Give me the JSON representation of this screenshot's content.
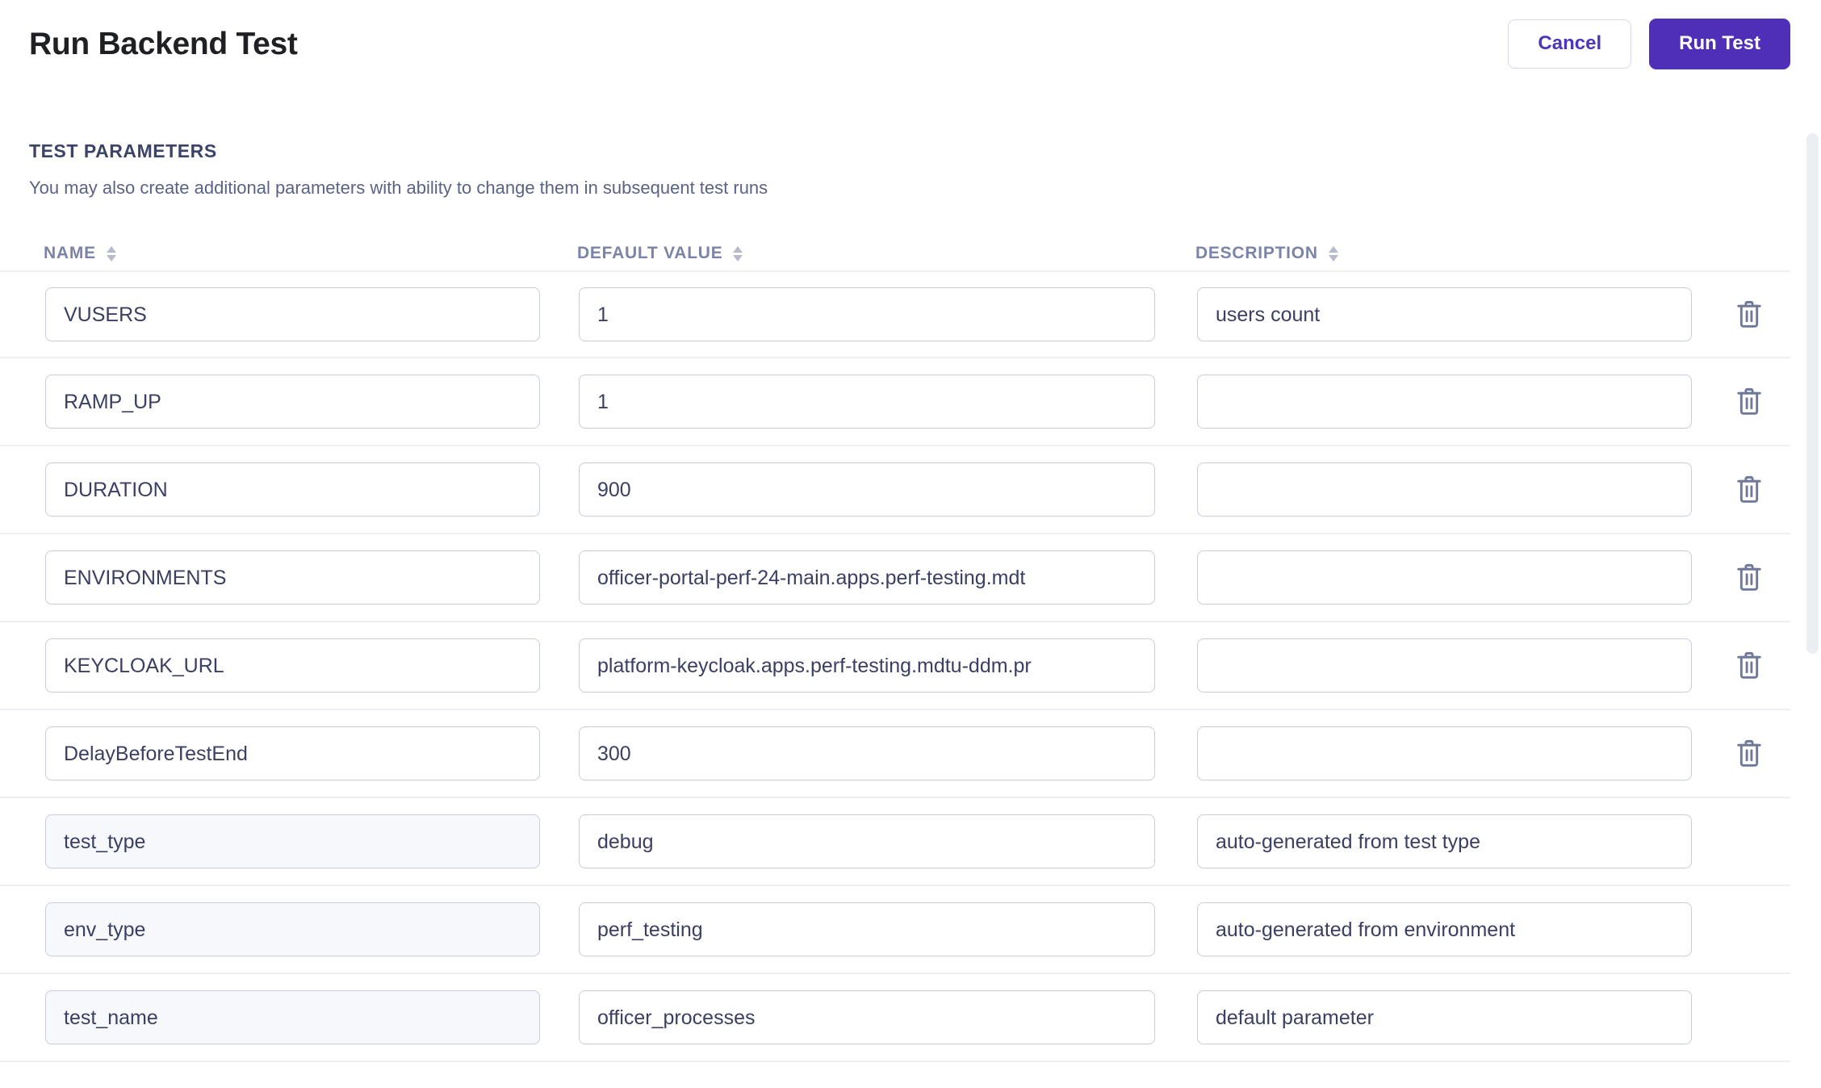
{
  "header": {
    "title": "Run Backend Test",
    "cancel_label": "Cancel",
    "run_label": "Run Test"
  },
  "section": {
    "title": "TEST PARAMETERS",
    "subtitle": "You may also create additional parameters with ability to change them in subsequent test runs"
  },
  "table": {
    "columns": [
      {
        "label": "NAME",
        "sort_icon": "sort-arrows-icon"
      },
      {
        "label": "DEFAULT VALUE",
        "sort_icon": "sort-arrows-icon"
      },
      {
        "label": "DESCRIPTION",
        "sort_icon": "sort-arrows-icon"
      }
    ],
    "rows": [
      {
        "name": "VUSERS",
        "value": "1",
        "description": "users count",
        "name_locked": false,
        "deletable": true,
        "delete_icon": "trash-icon"
      },
      {
        "name": "RAMP_UP",
        "value": "1",
        "description": "",
        "name_locked": false,
        "deletable": true,
        "delete_icon": "trash-icon"
      },
      {
        "name": "DURATION",
        "value": "900",
        "description": "",
        "name_locked": false,
        "deletable": true,
        "delete_icon": "trash-icon"
      },
      {
        "name": "ENVIRONMENTS",
        "value": "officer-portal-perf-24-main.apps.perf-testing.mdt",
        "description": "",
        "name_locked": false,
        "deletable": true,
        "delete_icon": "trash-icon"
      },
      {
        "name": "KEYCLOAK_URL",
        "value": "platform-keycloak.apps.perf-testing.mdtu-ddm.pr",
        "description": "",
        "name_locked": false,
        "deletable": true,
        "delete_icon": "trash-icon"
      },
      {
        "name": "DelayBeforeTestEnd",
        "value": "300",
        "description": "",
        "name_locked": false,
        "deletable": true,
        "delete_icon": "trash-icon"
      },
      {
        "name": "test_type",
        "value": "debug",
        "description": "auto-generated from test type",
        "name_locked": true,
        "deletable": false,
        "delete_icon": ""
      },
      {
        "name": "env_type",
        "value": "perf_testing",
        "description": "auto-generated from environment",
        "name_locked": true,
        "deletable": false,
        "delete_icon": ""
      },
      {
        "name": "test_name",
        "value": "officer_processes",
        "description": "default parameter",
        "name_locked": true,
        "deletable": false,
        "delete_icon": ""
      }
    ]
  },
  "colors": {
    "accent": "#4f2fb8",
    "accent_text": "#4f35bd",
    "heading": "#3b4368",
    "body_text": "#3a3f63",
    "muted": "#7b84a8",
    "border": "#c7cddb",
    "locked_bg": "#f6f8fb",
    "divider": "#eeeff2"
  },
  "scrollbar": {
    "orientation": "vertical",
    "thumb_label": "vertical-scroll-thumb"
  }
}
